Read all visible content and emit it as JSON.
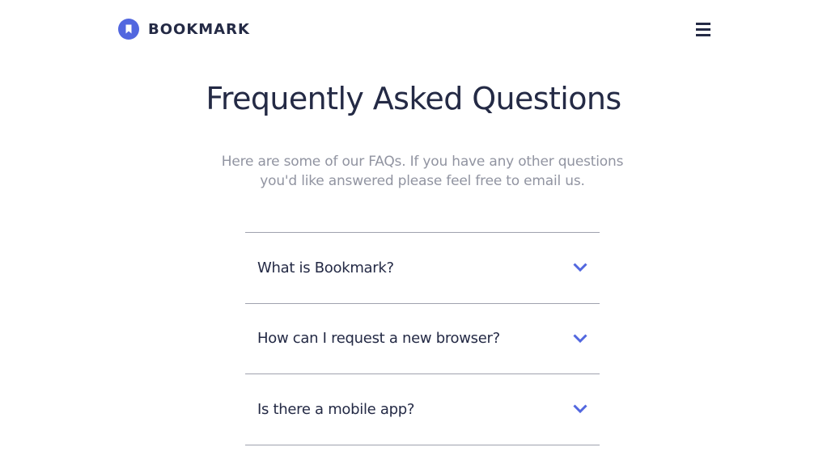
{
  "brand": {
    "name": "BOOKMARK",
    "logo_icon": "bookmark-icon",
    "accent_color": "#5267df",
    "text_color": "#242a45"
  },
  "nav": {
    "menu_icon": "hamburger-menu-icon"
  },
  "faq": {
    "title": "Frequently Asked Questions",
    "intro": "Here are some of our FAQs. If you have any other questions you'd like answered please feel free to email us.",
    "items": [
      {
        "question": "What is Bookmark?",
        "icon": "chevron-down-icon"
      },
      {
        "question": "How can I request a new browser?",
        "icon": "chevron-down-icon"
      },
      {
        "question": "Is there a mobile app?",
        "icon": "chevron-down-icon"
      }
    ]
  }
}
